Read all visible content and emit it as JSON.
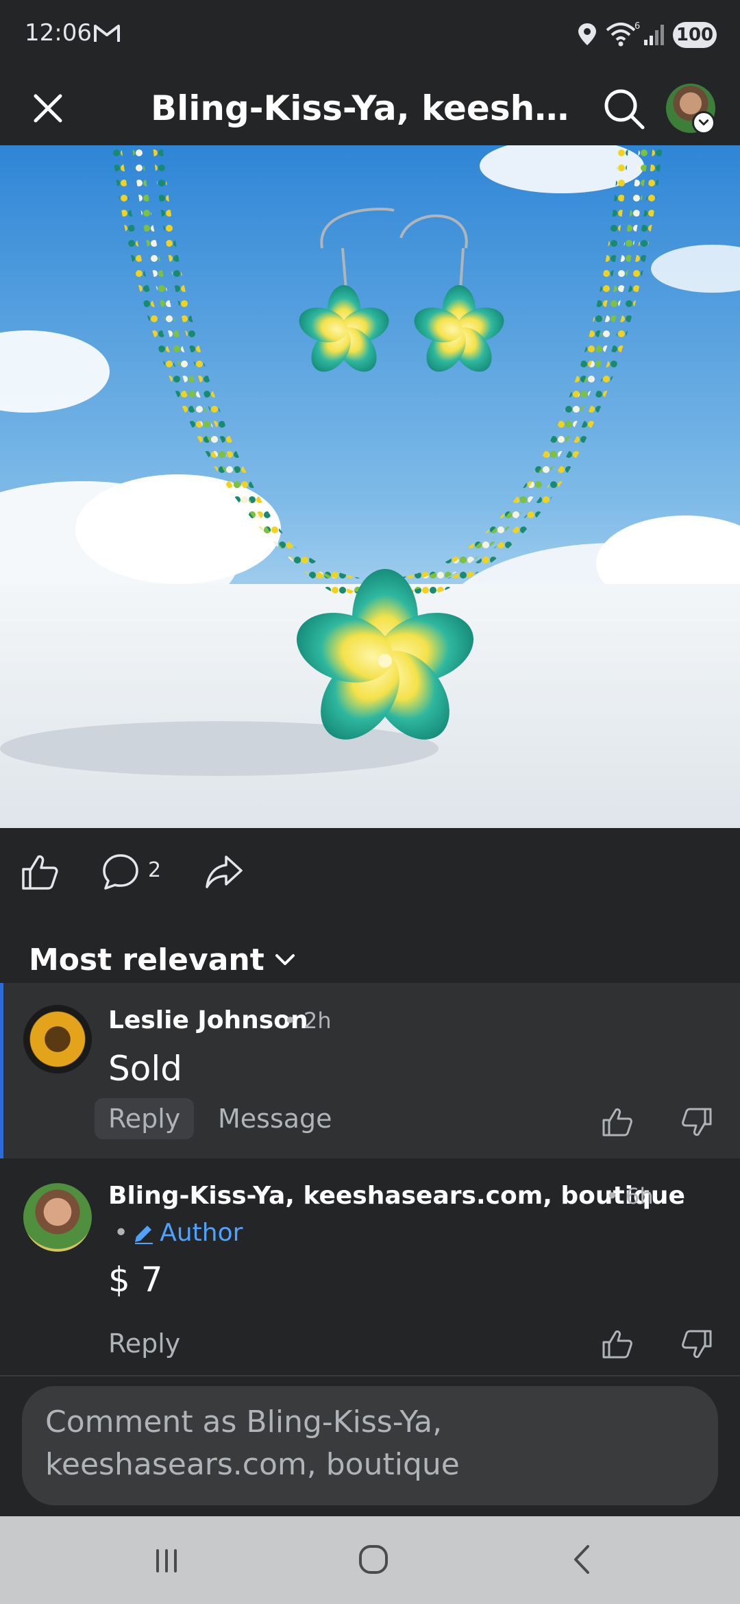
{
  "status_bar": {
    "time": "12:06",
    "battery": "100",
    "network": "6"
  },
  "header": {
    "title": "Bling-Kiss-Ya, keeshase..."
  },
  "actions": {
    "comment_count": "2"
  },
  "comments_section": {
    "sort_label": "Most relevant"
  },
  "comments": [
    {
      "author": "Leslie Johnson",
      "time": "• 2h",
      "text": "Sold",
      "reply_label": "Reply",
      "message_label": "Message"
    },
    {
      "author": "Bling-Kiss-Ya, keeshasears.com, boutique",
      "time": "• 6h",
      "badge_prefix": "•",
      "badge": "Author",
      "text": "$ 7",
      "reply_label": "Reply"
    }
  ],
  "composer": {
    "placeholder_line1": "Comment as Bling-Kiss-Ya,",
    "placeholder_line2": "keeshasears.com, boutique"
  },
  "colors": {
    "background": "#242527",
    "comment_highlight": "#303133",
    "accent_blue": "#4da3ff",
    "selection_bar": "#2d6bd9"
  }
}
